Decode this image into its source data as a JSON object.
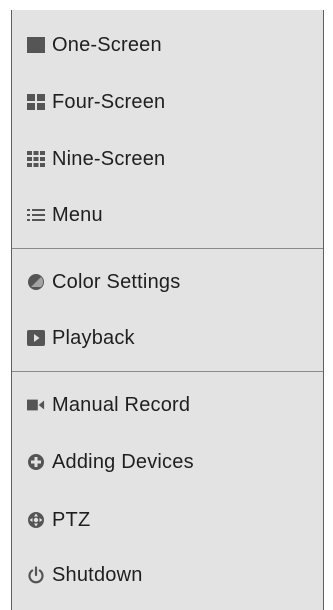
{
  "menu": {
    "items": [
      {
        "label": "One-Screen",
        "icon": "one-screen-icon"
      },
      {
        "label": "Four-Screen",
        "icon": "four-screen-icon"
      },
      {
        "label": "Nine-Screen",
        "icon": "nine-screen-icon"
      },
      {
        "label": "Menu",
        "icon": "menu-list-icon"
      },
      {
        "label": "Color Settings",
        "icon": "color-settings-icon"
      },
      {
        "label": "Playback",
        "icon": "playback-icon"
      },
      {
        "label": "Manual Record",
        "icon": "video-camera-icon"
      },
      {
        "label": "Adding Devices",
        "icon": "add-device-icon"
      },
      {
        "label": "PTZ",
        "icon": "ptz-icon"
      },
      {
        "label": "Shutdown",
        "icon": "power-icon"
      }
    ]
  },
  "colors": {
    "background": "#e3e3e3",
    "icon": "#555555",
    "text": "#1f1f1f",
    "divider": "#8a8a8a"
  }
}
